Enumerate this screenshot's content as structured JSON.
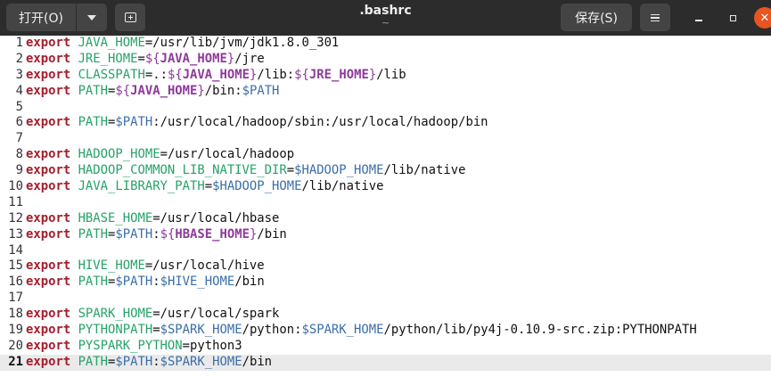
{
  "header": {
    "open_label": "打开(O)",
    "title": ".bashrc",
    "subtitle": "~",
    "save_label": "保存(S)"
  },
  "editor": {
    "current_line": 21,
    "lines": [
      {
        "n": "1",
        "text": "export JAVA_HOME=/usr/lib/jvm/jdk1.8.0_301"
      },
      {
        "n": "2",
        "text": "export JRE_HOME=${JAVA_HOME}/jre"
      },
      {
        "n": "3",
        "text": "export CLASSPATH=.:${JAVA_HOME}/lib:${JRE_HOME}/lib"
      },
      {
        "n": "4",
        "text": "export PATH=${JAVA_HOME}/bin:$PATH"
      },
      {
        "n": "5",
        "text": ""
      },
      {
        "n": "6",
        "text": "export PATH=$PATH:/usr/local/hadoop/sbin:/usr/local/hadoop/bin"
      },
      {
        "n": "7",
        "text": ""
      },
      {
        "n": "8",
        "text": "export HADOOP_HOME=/usr/local/hadoop"
      },
      {
        "n": "9",
        "text": "export HADOOP_COMMON_LIB_NATIVE_DIR=$HADOOP_HOME/lib/native"
      },
      {
        "n": "10",
        "text": "export JAVA_LIBRARY_PATH=$HADOOP_HOME/lib/native"
      },
      {
        "n": "11",
        "text": ""
      },
      {
        "n": "12",
        "text": "export HBASE_HOME=/usr/local/hbase"
      },
      {
        "n": "13",
        "text": "export PATH=$PATH:${HBASE_HOME}/bin"
      },
      {
        "n": "14",
        "text": ""
      },
      {
        "n": "15",
        "text": "export HIVE_HOME=/usr/local/hive"
      },
      {
        "n": "16",
        "text": "export PATH=$PATH:$HIVE_HOME/bin"
      },
      {
        "n": "17",
        "text": ""
      },
      {
        "n": "18",
        "text": "export SPARK_HOME=/usr/local/spark"
      },
      {
        "n": "19",
        "text": "export PYTHONPATH=$SPARK_HOME/python:$SPARK_HOME/python/lib/py4j-0.10.9-src.zip:PYTHONPATH"
      },
      {
        "n": "20",
        "text": "export PYSPARK_PYTHON=python3"
      },
      {
        "n": "21",
        "text": "export PATH=$PATH:$SPARK_HOME/bin"
      }
    ]
  },
  "colors": {
    "header_bg": "#2c2c2c",
    "button_bg": "#444444",
    "close_button": "#e95420",
    "keyword": "#a51d2d",
    "variable_name": "#26a269",
    "variable_ref": "#3b6ea8",
    "brace_var": "#8e3a9a",
    "current_line_bg": "#eaeaea"
  },
  "icons": {
    "open_menu": "chevron-down-icon",
    "new_tab": "new-tab-icon",
    "menu": "hamburger-menu-icon",
    "minimize": "minimize-icon",
    "maximize": "maximize-icon",
    "close": "close-icon"
  }
}
